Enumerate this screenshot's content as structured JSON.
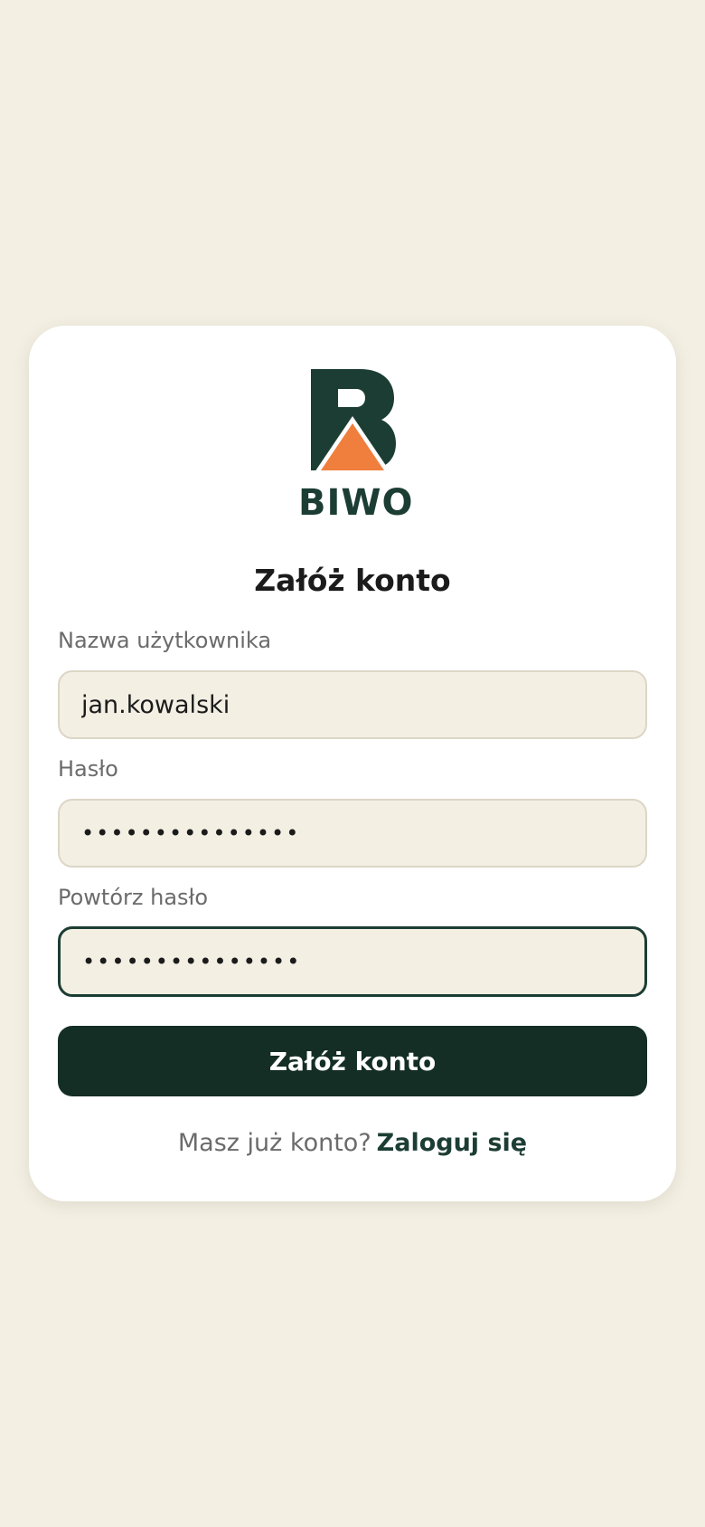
{
  "brand": {
    "name": "BIWO",
    "logo_icon": "biwo-tent-b-logo",
    "primary_color": "#1c3d33",
    "accent_color": "#f07f3e"
  },
  "form": {
    "title": "Załóż konto",
    "username": {
      "label": "Nazwa użytkownika",
      "value": "jan.kowalski"
    },
    "password": {
      "label": "Hasło",
      "value": "•••••••••••••••"
    },
    "confirm_password": {
      "label": "Powtórz hasło",
      "value": "•••••••••••••••"
    },
    "submit_label": "Załóż konto"
  },
  "footer": {
    "prompt": "Masz już konto?",
    "login_link": "Zaloguj się"
  },
  "colors": {
    "background": "#f3efe3",
    "card": "#ffffff",
    "button": "#142e25",
    "label": "#6b6b6b"
  }
}
